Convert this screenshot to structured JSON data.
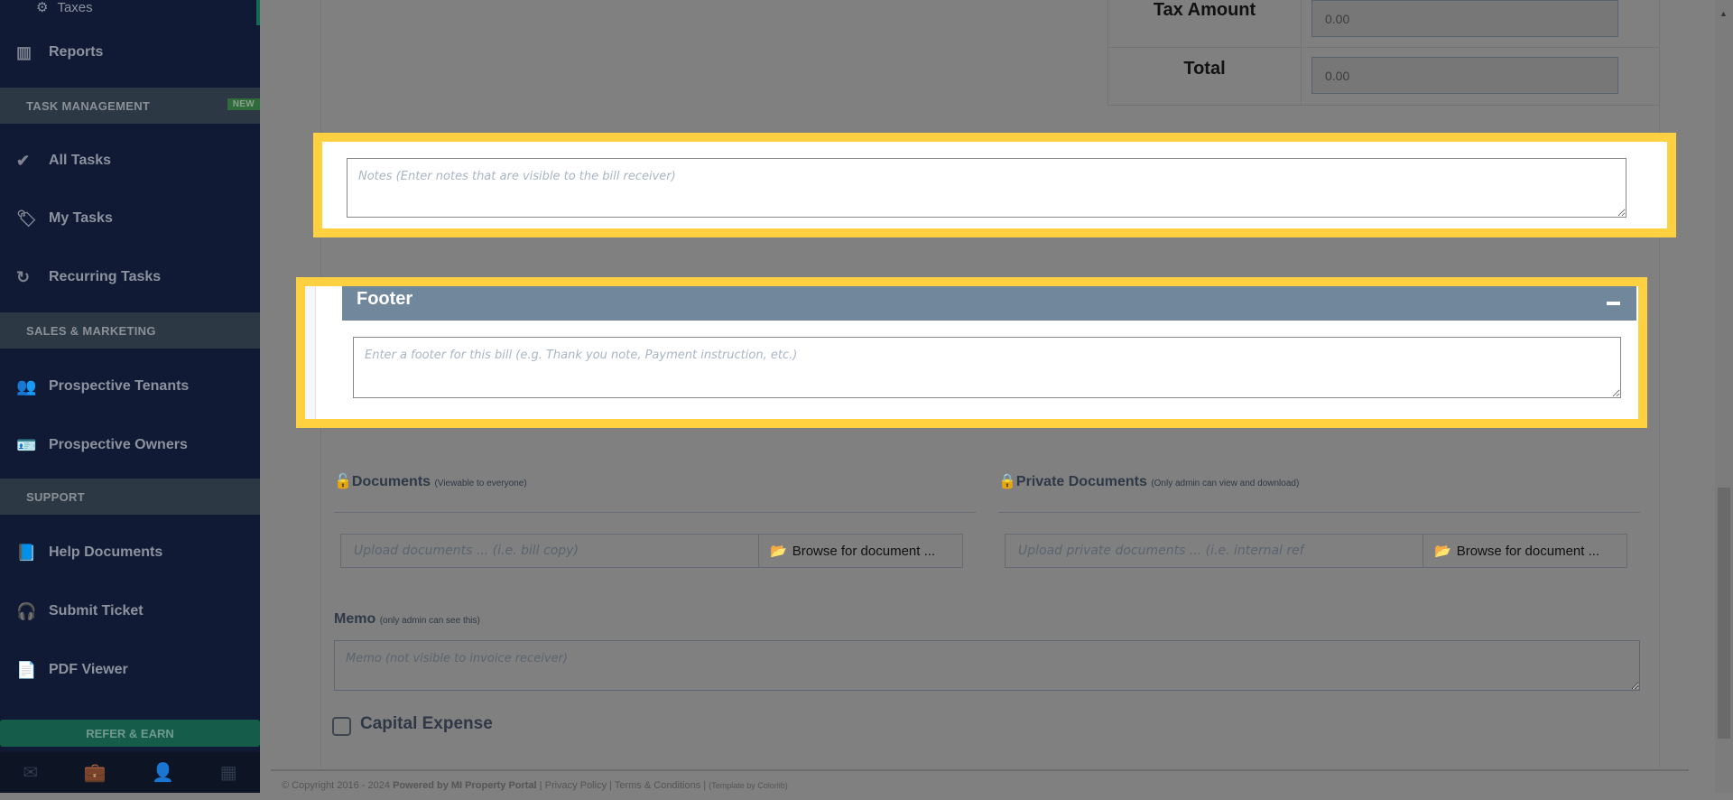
{
  "sidebar": {
    "taxes": "Taxes",
    "reports": "Reports",
    "task_header": "TASK MANAGEMENT",
    "new_badge": "NEW",
    "all_tasks": "All Tasks",
    "my_tasks": "My Tasks",
    "recurring_tasks": "Recurring Tasks",
    "sales_header": "SALES & MARKETING",
    "prospective_tenants": "Prospective Tenants",
    "prospective_owners": "Prospective Owners",
    "support_header": "SUPPORT",
    "help_documents": "Help Documents",
    "submit_ticket": "Submit Ticket",
    "pdf_viewer": "PDF Viewer",
    "refer": "REFER & EARN"
  },
  "totals": {
    "tax_amount_label": "Tax Amount",
    "tax_amount_value": "0.00",
    "total_label": "Total",
    "total_value": "0.00"
  },
  "notes": {
    "placeholder": "Notes (Enter notes that are visible to the bill receiver)"
  },
  "footer": {
    "title": "Footer",
    "placeholder": "Enter a footer for this bill (e.g. Thank you note, Payment instruction, etc.)"
  },
  "documents": {
    "label": "Documents",
    "hint": "(Viewable to everyone)",
    "placeholder": "Upload documents ... (i.e. bill copy)",
    "browse": "Browse for document ..."
  },
  "private_documents": {
    "label": "Private Documents",
    "hint": "(Only admin can view and download)",
    "placeholder": "Upload private documents ... (i.e. internal ref",
    "browse": "Browse for document ..."
  },
  "memo": {
    "label": "Memo",
    "hint": "(only admin can see this)",
    "placeholder": "Memo (not visible to invoice receiver)"
  },
  "capital_expense": {
    "label": "Capital Expense",
    "checked": false
  },
  "page_footer": {
    "copyright": "© Copyright 2016 - 2024",
    "powered": "Powered by MI Property Portal",
    "privacy": "Privacy Policy",
    "terms": "Terms & Conditions",
    "template": "(Template by Colorlib)"
  }
}
